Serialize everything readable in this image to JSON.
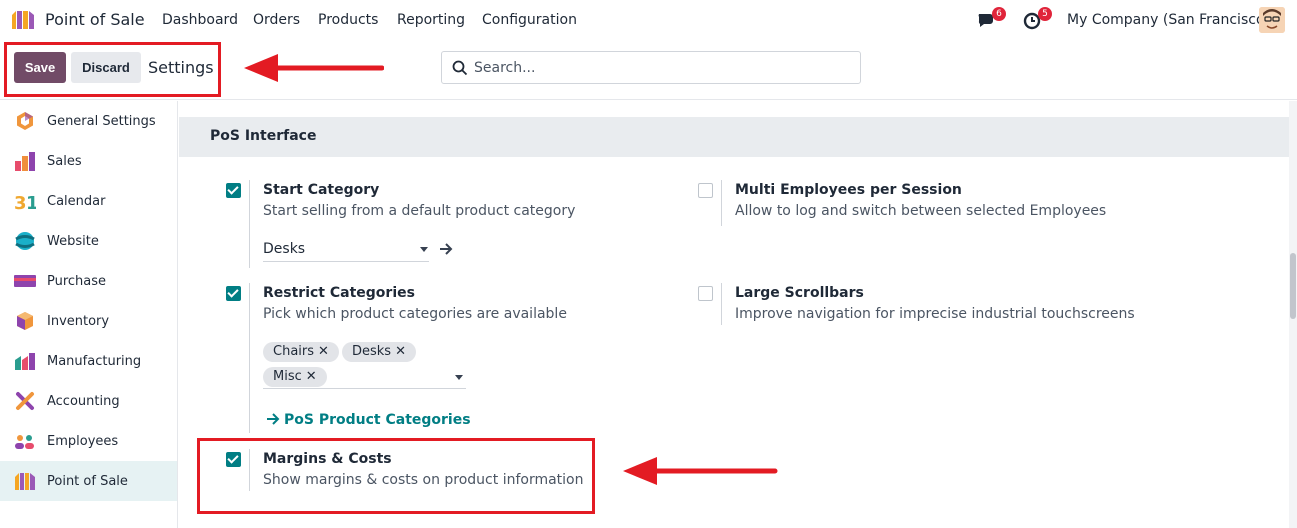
{
  "navbar": {
    "app_name": "Point of Sale",
    "menu": [
      "Dashboard",
      "Orders",
      "Products",
      "Reporting",
      "Configuration"
    ],
    "messages_count": "6",
    "activities_count": "5",
    "company": "My Company (San Francisco)"
  },
  "control": {
    "save_label": "Save",
    "discard_label": "Discard",
    "title": "Settings",
    "search_placeholder": "Search..."
  },
  "sidebar": {
    "items": [
      {
        "label": "General Settings",
        "icon": "general-settings-icon"
      },
      {
        "label": "Sales",
        "icon": "sales-icon"
      },
      {
        "label": "Calendar",
        "icon": "calendar-icon"
      },
      {
        "label": "Website",
        "icon": "website-icon"
      },
      {
        "label": "Purchase",
        "icon": "purchase-icon"
      },
      {
        "label": "Inventory",
        "icon": "inventory-icon"
      },
      {
        "label": "Manufacturing",
        "icon": "manufacturing-icon"
      },
      {
        "label": "Accounting",
        "icon": "accounting-icon"
      },
      {
        "label": "Employees",
        "icon": "employees-icon"
      },
      {
        "label": "Point of Sale",
        "icon": "point-of-sale-icon",
        "active": true
      }
    ]
  },
  "section": {
    "title": "PoS Interface",
    "settings": {
      "start_category": {
        "title": "Start Category",
        "desc": "Start selling from a default product category",
        "checked": true,
        "value": "Desks"
      },
      "multi_employees": {
        "title": "Multi Employees per Session",
        "desc": "Allow to log and switch between selected Employees",
        "checked": false
      },
      "restrict_categories": {
        "title": "Restrict Categories",
        "desc": "Pick which product categories are available",
        "checked": true,
        "tags": [
          "Chairs",
          "Desks",
          "Misc"
        ],
        "link": "PoS Product Categories"
      },
      "large_scrollbars": {
        "title": "Large Scrollbars",
        "desc": "Improve navigation for imprecise industrial touchscreens",
        "checked": false
      },
      "margins_costs": {
        "title": "Margins & Costs",
        "desc": "Show margins & costs on product information",
        "checked": true
      }
    }
  },
  "colors": {
    "brand": "#714b67",
    "accent": "#017e84",
    "annotation": "#e31b23"
  }
}
